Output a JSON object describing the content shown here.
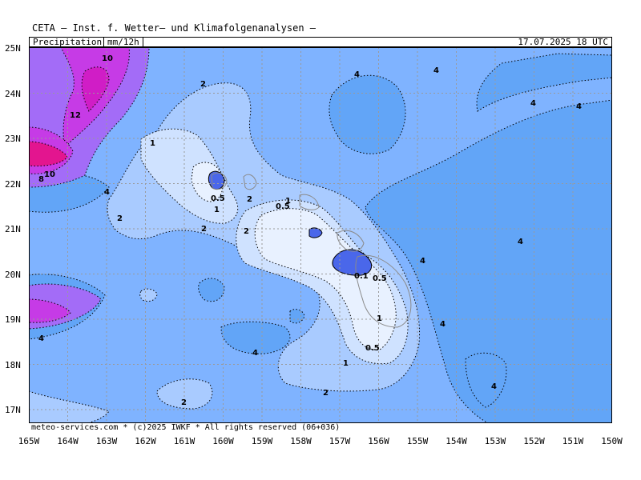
{
  "header": {
    "title": "CETA — Inst. f. Wetter— und Klimafolgenanalysen —"
  },
  "info": {
    "parameter": "Precipitation",
    "unit": "mm/12h",
    "valid_time": "17.07.2025 18 UTC"
  },
  "credit": "meteo-services.com * (c)2025 IWKF * All rights reserved (06+036)",
  "axes": {
    "lat_labels": [
      "25N",
      "24N",
      "23N",
      "22N",
      "21N",
      "20N",
      "19N",
      "18N",
      "17N"
    ],
    "lon_labels": [
      "165W",
      "164W",
      "163W",
      "162W",
      "161W",
      "160W",
      "159W",
      "158W",
      "157W",
      "156W",
      "155W",
      "154W",
      "153W",
      "152W",
      "151W",
      "150W"
    ]
  },
  "colors": {
    "base": "#7fb3ff",
    "level_4": "#62a5f7",
    "level_2": "#a9cbff",
    "level_1": "#cfe2ff",
    "level_05": "#e8f1ff",
    "level_01": "#4a67ea",
    "heavy_8": "#a36cf7",
    "heavy_10": "#c63be6",
    "heavy_12": "#e3158f"
  },
  "contour_labels": [
    {
      "text": "10"
    },
    {
      "text": "12"
    },
    {
      "text": "10"
    },
    {
      "text": "8"
    },
    {
      "text": "4"
    },
    {
      "text": "2"
    },
    {
      "text": "1"
    },
    {
      "text": "2"
    },
    {
      "text": "0.5"
    },
    {
      "text": "1"
    },
    {
      "text": "2"
    },
    {
      "text": "1"
    },
    {
      "text": "0.5"
    },
    {
      "text": "2"
    },
    {
      "text": "0.1"
    },
    {
      "text": "0.5"
    },
    {
      "text": "1"
    },
    {
      "text": "0.5"
    },
    {
      "text": "1"
    },
    {
      "text": "2"
    },
    {
      "text": "4"
    },
    {
      "text": "2"
    },
    {
      "text": "4"
    },
    {
      "text": "4"
    },
    {
      "text": "4"
    },
    {
      "text": "4"
    },
    {
      "text": "4"
    },
    {
      "text": "4"
    },
    {
      "text": "4"
    },
    {
      "text": "4"
    },
    {
      "text": "4"
    },
    {
      "text": "2"
    }
  ]
}
